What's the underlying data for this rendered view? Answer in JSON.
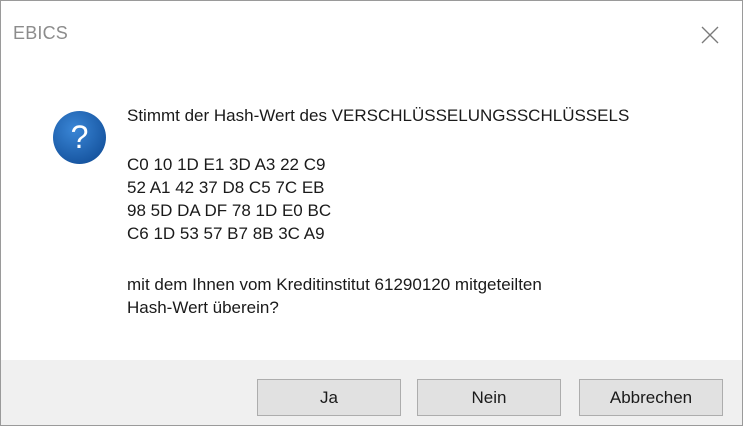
{
  "window": {
    "title": "EBICS",
    "close_icon": "close-icon"
  },
  "dialog": {
    "icon": "question-icon",
    "icon_color": "#1a5fa8",
    "question_line": "Stimmt der Hash-Wert des VERSCHLÜSSELUNGSSCHLÜSSELS",
    "hash_lines": [
      "C0 10 1D E1 3D A3 22 C9",
      "52 A1 42 37 D8 C5 7C EB",
      "98 5D DA DF 78 1D E0 BC",
      "C6 1D 53 57 B7 8B 3C A9"
    ],
    "closing_lines": [
      "mit dem Ihnen vom Kreditinstitut 61290120 mitgeteilten",
      "Hash-Wert überein?"
    ]
  },
  "buttons": {
    "yes_label": "Ja",
    "no_label": "Nein",
    "cancel_label": "Abbrechen"
  }
}
